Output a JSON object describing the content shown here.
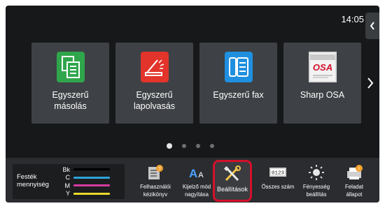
{
  "status": {
    "clock": "14:05"
  },
  "home": {
    "tiles": [
      {
        "label": "Egyszerű másolás",
        "icon": "copy-icon",
        "color": "#2fa64c"
      },
      {
        "label": "Egyszerű lapolvasás",
        "icon": "scan-icon",
        "color": "#e2342a"
      },
      {
        "label": "Egyszerű fax",
        "icon": "fax-icon",
        "color": "#1f8fe0"
      },
      {
        "label": "Sharp OSA",
        "icon": "osa-logo-icon",
        "logo_text": "OSA",
        "color": "#b5b5b5"
      }
    ],
    "pages": {
      "count": 4,
      "current": 1
    }
  },
  "toner": {
    "label_line1": "Festék",
    "label_line2": "mennyiség",
    "colors": [
      {
        "letter": "Bk",
        "color": "#000000",
        "level": 1.0
      },
      {
        "letter": "C",
        "color": "#2fa4d9",
        "level": 1.0
      },
      {
        "letter": "M",
        "color": "#d63aa2",
        "level": 1.0
      },
      {
        "letter": "Y",
        "color": "#e9d92a",
        "level": 1.0
      }
    ]
  },
  "shortcuts": {
    "manual": {
      "line1": "Felhasználói",
      "line2": "kézikönyv",
      "icon": "manual-icon"
    },
    "display": {
      "line1": "Kijelző mód",
      "line2": "nagyítása",
      "icon": "font-size-icon"
    },
    "settings": {
      "line1": "Beállítások",
      "icon": "wrench-screwdriver-icon",
      "selected": true
    },
    "counter": {
      "line1": "Összes szám",
      "icon": "counter-icon",
      "counter_display": "0123"
    },
    "brightness": {
      "line1": "Fényesség",
      "line2": "beállítás",
      "icon": "brightness-icon"
    },
    "job_status": {
      "line1": "Feladat",
      "line2": "állapot",
      "icon": "job-status-icon"
    }
  },
  "accent": "#d3112b"
}
